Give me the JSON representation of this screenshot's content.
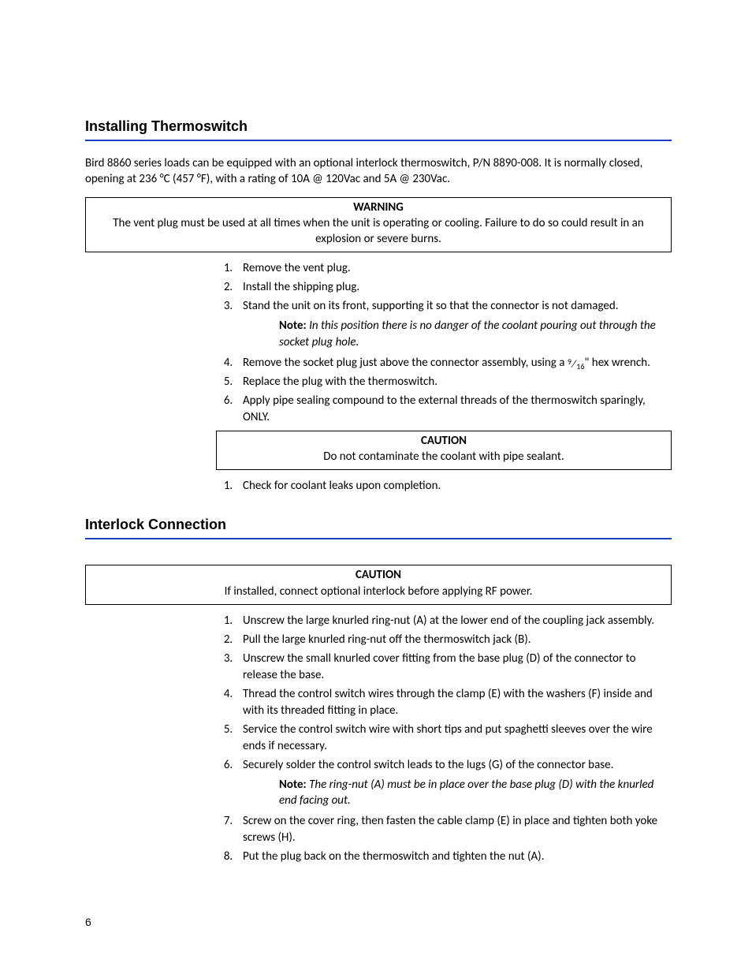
{
  "page_number": "6",
  "section1": {
    "heading": "Installing Thermoswitch",
    "intro": "Bird 8860 series loads can be equipped with an optional interlock thermoswitch, P/N 8890-008. It is normally closed, opening at 236 °C (457 °F), with a rating of 10A @ 120Vac and 5A @ 230Vac.",
    "warning": {
      "title": "WARNING",
      "body": "The vent plug must be used at all times when the unit is operating or cooling. Failure to do so could result in an explosion or severe burns."
    },
    "steps_a": {
      "s1": "Remove the vent plug.",
      "s2": "Install the shipping plug.",
      "s3": "Stand the unit on its front, supporting it so that the connector is not damaged."
    },
    "note1": {
      "label": "Note:",
      "text": "In this position there is no danger of the coolant pouring out through the socket plug hole."
    },
    "steps_b": {
      "s4a": "Remove the socket plug just above the connector assembly, using a ",
      "s4_frac_num": "9",
      "s4_frac_den": "16",
      "s4b": "\" hex wrench.",
      "s5": "Replace the plug with the thermoswitch.",
      "s6": "Apply pipe sealing compound to the external threads of the thermoswitch sparingly, ONLY."
    },
    "caution": {
      "title": "CAUTION",
      "body": "Do not contaminate the coolant with pipe sealant."
    },
    "steps_c": {
      "s1": "Check for coolant leaks upon completion."
    }
  },
  "section2": {
    "heading": "Interlock Connection",
    "caution": {
      "title": "CAUTION",
      "body": "If installed, connect optional interlock before applying RF power."
    },
    "steps_a": {
      "s1": "Unscrew the large knurled ring-nut (A) at the lower end of the coupling jack assembly.",
      "s2": "Pull the large knurled ring-nut off the thermoswitch jack (B).",
      "s3": "Unscrew the small knurled cover fitting from the base plug (D) of the connector to release the base.",
      "s4": "Thread the control switch wires through the clamp (E) with the washers (F) inside and with its threaded fitting in place.",
      "s5": "Service the control switch wire with short tips and put spaghetti sleeves over the wire ends if necessary.",
      "s6": "Securely solder the control switch leads to the lugs (G) of the connector base."
    },
    "note1": {
      "label": "Note:",
      "text": "The ring-nut (A) must be in place over the base plug (D) with the knurled end facing out."
    },
    "steps_b": {
      "s7": "Screw on the cover ring, then fasten the cable clamp (E) in place and tighten both yoke screws (H).",
      "s2b": "Put the plug back on the thermoswitch and tighten the nut (A)."
    }
  }
}
